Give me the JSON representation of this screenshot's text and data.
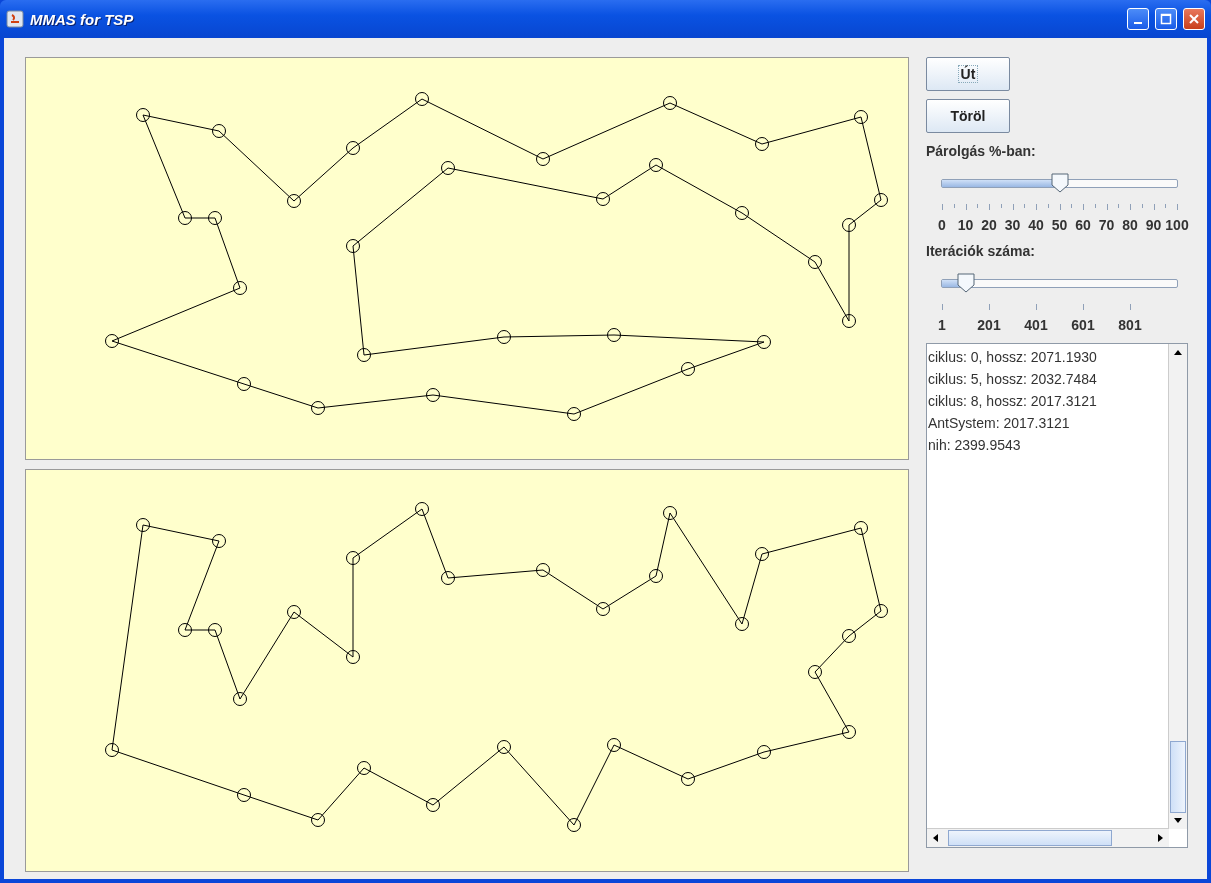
{
  "window": {
    "title": "MMAS for TSP"
  },
  "buttons": [
    {
      "label": "Út",
      "focused": true
    },
    {
      "label": "Töröl",
      "focused": false
    }
  ],
  "sliders": [
    {
      "label": "Párolgás %-ban:",
      "level": 0.5,
      "tick_labels": [
        "0",
        "10",
        "20",
        "30",
        "40",
        "50",
        "60",
        "70",
        "80",
        "90",
        "100"
      ]
    },
    {
      "label": "Iterációk száma:",
      "level": 0.1,
      "tick_labels": [
        "1",
        "201",
        "401",
        "601",
        "801"
      ]
    }
  ],
  "log": {
    "lines": [
      "ciklus: 0, hossz: 2071.1930",
      "ciklus: 5, hossz: 2032.7484",
      "ciklus: 8, hossz: 2017.3121",
      "AntSystem: 2017.3121",
      "nih: 2399.9543"
    ]
  }
}
